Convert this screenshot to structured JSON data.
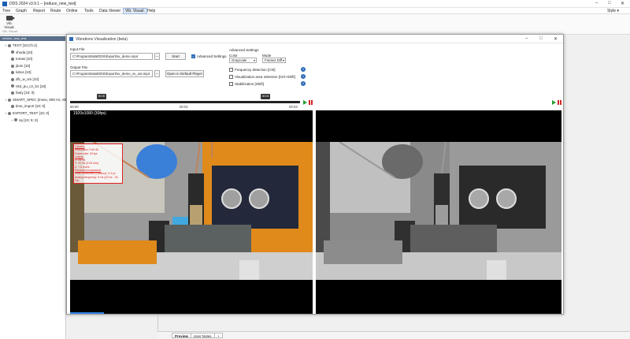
{
  "app": {
    "title": "DDS 2024 v3.9.1 – [reduce_new_test]",
    "menu": [
      "Tree",
      "Graph",
      "Report",
      "Route",
      "Online",
      "Tools",
      "Data Viewer",
      "Vib. Visual.",
      "Help"
    ],
    "active_menu": "Vib. Visual.",
    "style_label": "Style",
    "ribbon_button": "Vib. Visual.",
    "ribbon_group": "Vib. Visual."
  },
  "tree": {
    "header": "reduce_new_test",
    "items": [
      {
        "label": "TEST [10;Ch:1]",
        "expand": "+"
      },
      {
        "label": "shoda [10]",
        "expand": ""
      },
      {
        "label": "tomas [10]",
        "expand": ""
      },
      {
        "label": "jitom [10]",
        "expand": ""
      },
      {
        "label": "lubos [10]",
        "expand": ""
      },
      {
        "label": "dfc_w_sm [10]",
        "expand": ""
      },
      {
        "label": "nk3_pu_c2_b1 [10]",
        "expand": ""
      },
      {
        "label": "fauty [10; 0]",
        "expand": ""
      },
      {
        "label": "SMART_SPEC [mnex, 800 Hz, 800;",
        "expand": "+"
      },
      {
        "label": "time_import [10; 0]",
        "expand": ""
      },
      {
        "label": "EXPORT_TEST [10; 0]",
        "expand": "+"
      },
      {
        "label": "np [10; 8; 0]",
        "expand": "+"
      }
    ]
  },
  "bottom_tabs": [
    "Preview",
    "User Notes",
    "+"
  ],
  "dialog": {
    "title": "Vibrations Visualization (beta)",
    "input_file_label": "Input File",
    "input_path": "C:\\ProgramData\\DDS\\Export\\sv_demo.mp4",
    "start_label": "Start",
    "advanced_label": "Advanced Settings",
    "output_file_label": "Output File",
    "output_path": "C:\\ProgramData\\DDS\\Export\\sv_demo_vv_out.mp4",
    "open_player_label": "Open in Default Player",
    "browse": "...",
    "adv_title": "Advanced Settings",
    "color_label": "Color",
    "color_value": "Grayscale",
    "mode_label": "Mode",
    "mode_value": "Frames Diff",
    "options": [
      "Frequency detection [Ctrl]",
      "Visualization area selection [Ctrl+Shift]",
      "Stabilization [Shift]"
    ],
    "handle_start": "00:00",
    "handle_end": "00:03",
    "time_start": "00:00",
    "time_mid": "00:01",
    "time_end": "00:03",
    "resolution": "1920x1080 (30fps)",
    "overlay": {
      "s1_title": "Camera",
      "s1": [
        "Resolution: Full HD",
        "Frame rate: 30 fps"
      ],
      "s2_title": "Output",
      "s2": [
        "X: 25 Hz",
        "Y: 20 Hz (0.05 mm)",
        "Z: 7.5 mm/s"
      ],
      "s3_title": "Perceived movement",
      "s3": [
        "Peak movement (rotation): 0.3 px",
        "Analog frequency: 5 Hz (20 Hz - 30 Hz)"
      ]
    },
    "progress": 0.14
  }
}
